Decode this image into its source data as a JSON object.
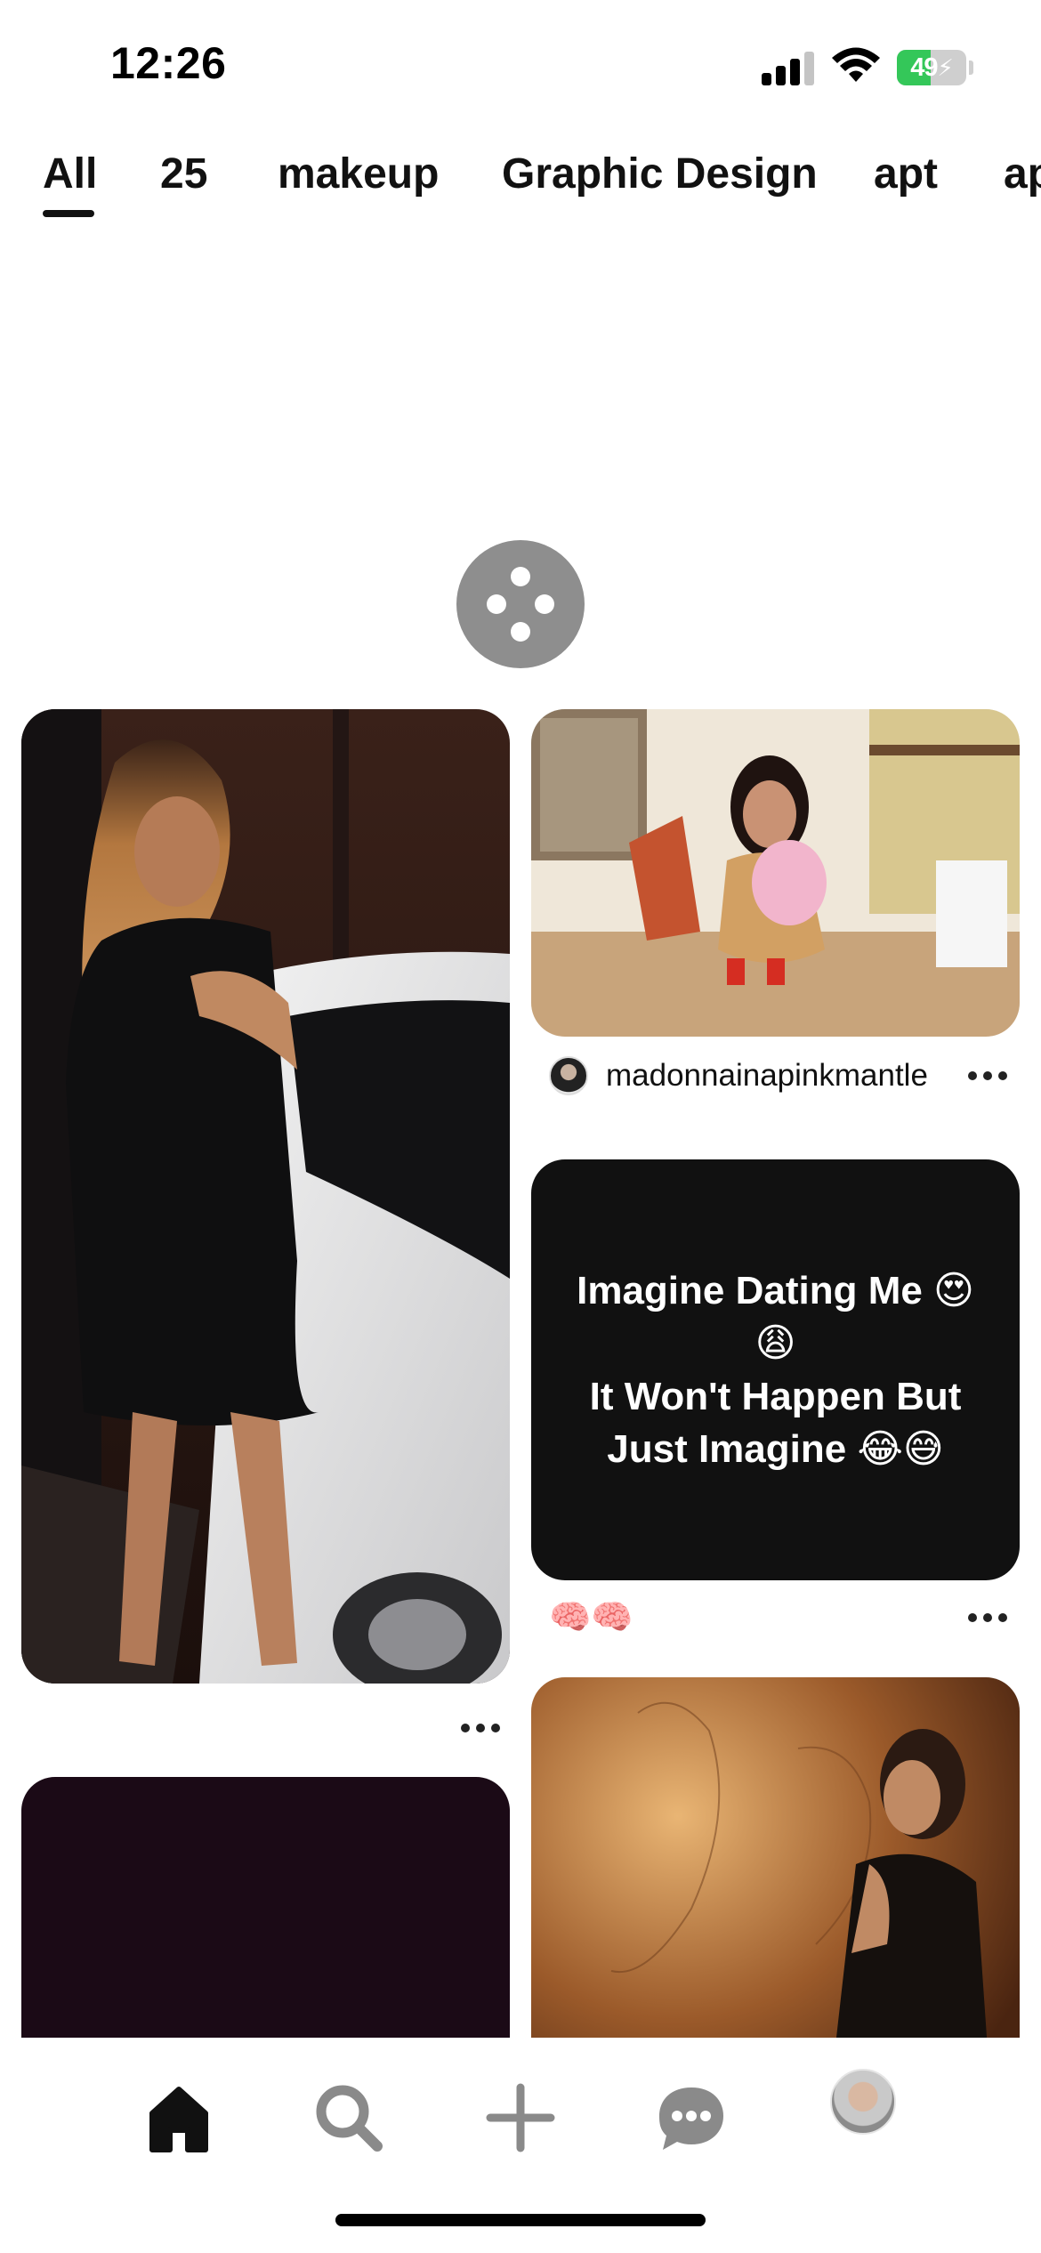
{
  "status_bar": {
    "time": "12:26",
    "battery_percent": "49",
    "battery_level": 0.49,
    "battery_color": "#34c759"
  },
  "tabs": [
    {
      "label": "All",
      "selected": true
    },
    {
      "label": "25"
    },
    {
      "label": "makeup"
    },
    {
      "label": "Graphic Design"
    },
    {
      "label": "apt"
    },
    {
      "label": "ap"
    }
  ],
  "pins": {
    "left_1": {
      "image": "woman in black dress beside white car"
    },
    "right_1": {
      "image": "woman holding stuffed animal in boutique",
      "pinner": "madonnainapinkmantle"
    },
    "right_2": {
      "text": "Imagine Dating Me 😍\n😩\nIt Won't Happen But\nJust Imagine 😂😅",
      "background": "#111111",
      "caption": "🧠🧠"
    },
    "left_2": {
      "background": "#1b0a16"
    },
    "right_3": {
      "image": "woman posing against warm lit wall"
    }
  },
  "bottom_nav": {
    "items": [
      "home",
      "search",
      "create",
      "messages",
      "profile"
    ],
    "active": "home"
  }
}
